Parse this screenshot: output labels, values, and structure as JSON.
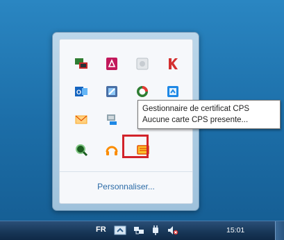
{
  "tray": {
    "customize_label": "Personnaliser...",
    "icons": [
      {
        "name": "green-monitor-icon"
      },
      {
        "name": "acrobat-icon"
      },
      {
        "name": "grey-app-icon"
      },
      {
        "name": "kaspersky-icon"
      },
      {
        "name": "outlook-icon"
      },
      {
        "name": "tool-icon"
      },
      {
        "name": "sync-icon"
      },
      {
        "name": "blue-window-icon"
      },
      {
        "name": "mail-envelope-icon"
      },
      {
        "name": "network-share-icon"
      },
      {
        "name": "hidden-icon"
      },
      {
        "name": "hidden-icon-2"
      },
      {
        "name": "search-icon"
      },
      {
        "name": "headphones-icon"
      },
      {
        "name": "cps-card-icon"
      }
    ]
  },
  "tooltip": {
    "line1": "Gestionnaire de certificat CPS",
    "line2": "Aucune carte CPS presente..."
  },
  "taskbar": {
    "language": "FR",
    "clock": "15:01"
  },
  "colors": {
    "highlight": "#d2232a",
    "desktop": "#1d73ad",
    "taskbar": "#173656"
  }
}
